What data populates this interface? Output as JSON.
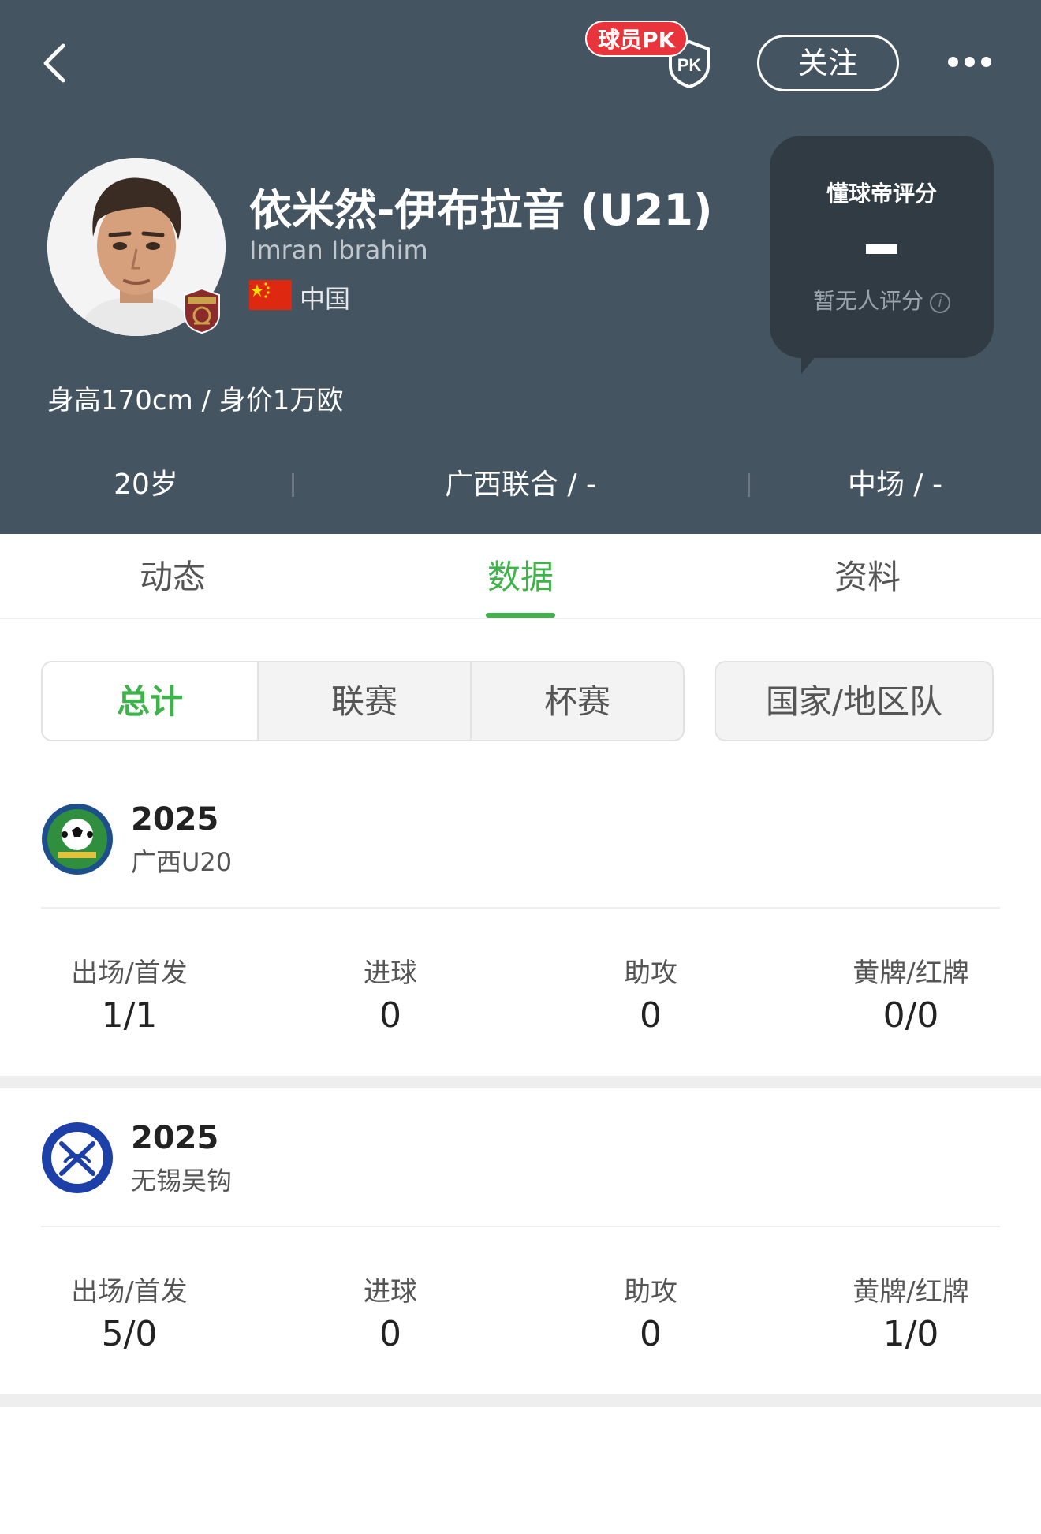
{
  "header": {
    "pk_badge": "球员PK",
    "follow_label": "关注",
    "player": {
      "name_cn": "依米然-伊布拉音 (U21)",
      "name_en": "Imran Ibrahim",
      "country": "中国",
      "height_value": "身高170cm / 身价1万欧"
    },
    "rating": {
      "title": "懂球帝评分",
      "subtitle": "暂无人评分"
    },
    "summary": {
      "age": "20岁",
      "team": "广西联合 / -",
      "position": "中场 / -"
    }
  },
  "tabs": [
    {
      "label": "动态",
      "active": false
    },
    {
      "label": "数据",
      "active": true
    },
    {
      "label": "资料",
      "active": false
    }
  ],
  "sub_tabs": [
    {
      "label": "总计",
      "active": true
    },
    {
      "label": "联赛",
      "active": false
    },
    {
      "label": "杯赛",
      "active": false
    },
    {
      "label": "国家/地区队",
      "active": false
    }
  ],
  "stat_labels": {
    "apps": "出场/首发",
    "goals": "进球",
    "assists": "助攻",
    "cards": "黄牌/红牌"
  },
  "seasons": [
    {
      "year": "2025",
      "team": "广西U20",
      "apps": "1/1",
      "goals": "0",
      "assists": "0",
      "cards": "0/0"
    },
    {
      "year": "2025",
      "team": "无锡吴钩",
      "apps": "5/0",
      "goals": "0",
      "assists": "0",
      "cards": "1/0"
    }
  ],
  "colors": {
    "header_bg": "#455461",
    "accent_green": "#3db34a",
    "pk_red": "#e8343a"
  }
}
